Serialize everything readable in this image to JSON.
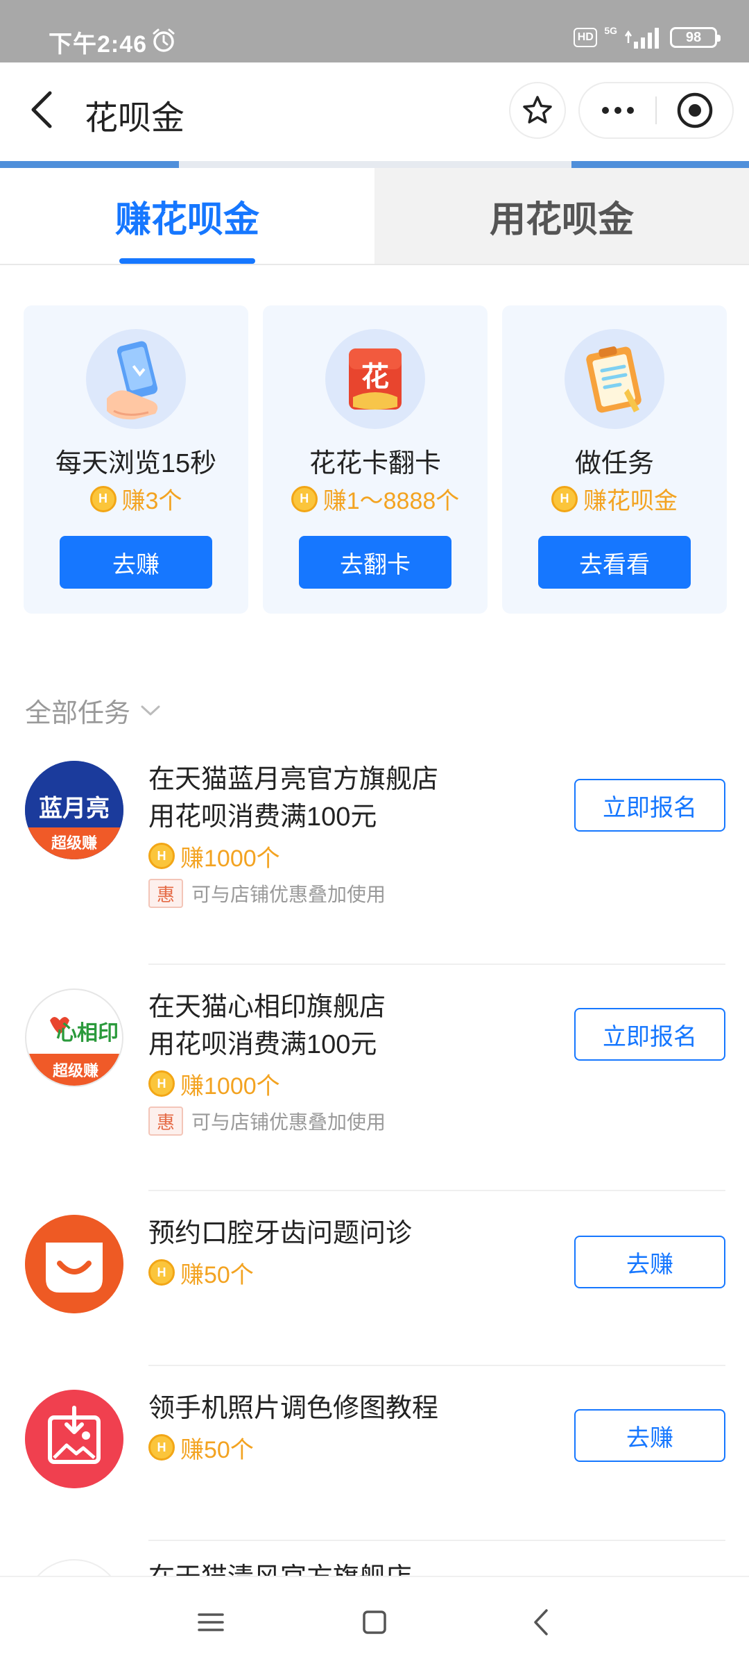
{
  "status_bar": {
    "time": "下午2:46",
    "hd": "HD",
    "network": "5G",
    "battery": "98"
  },
  "nav": {
    "title": "花呗金"
  },
  "tabs": [
    {
      "label": "赚花呗金",
      "active": true
    },
    {
      "label": "用花呗金",
      "active": false
    }
  ],
  "cards": [
    {
      "title": "每天浏览15秒",
      "reward": "赚3个",
      "button": "去赚",
      "icon": "phone-hand-icon"
    },
    {
      "title": "花花卡翻卡",
      "reward": "赚1～8888个",
      "button": "去翻卡",
      "icon": "flower-card-icon",
      "icon_text": "花"
    },
    {
      "title": "做任务",
      "reward": "赚花呗金",
      "button": "去看看",
      "icon": "clipboard-icon"
    }
  ],
  "section": {
    "title": "全部任务"
  },
  "coin_symbol": "H",
  "tasks": [
    {
      "title_line1": "在天猫蓝月亮官方旗舰店",
      "title_line2": "用花呗消费满100元",
      "reward": "赚1000个",
      "badge": "惠",
      "note": "可与店铺优惠叠加使用",
      "button": "立即报名",
      "logo_text": "蓝月亮",
      "logo_sub": "超级赚"
    },
    {
      "title_line1": "在天猫心相印旗舰店",
      "title_line2": "用花呗消费满100元",
      "reward": "赚1000个",
      "badge": "惠",
      "note": "可与店铺优惠叠加使用",
      "button": "立即报名",
      "logo_text": "心相印",
      "logo_sub": "超级赚"
    },
    {
      "title_line1": "预约口腔牙齿问题问诊",
      "reward": "赚50个",
      "button": "去赚"
    },
    {
      "title_line1": "领手机照片调色修图教程",
      "reward": "赚50个",
      "button": "去赚"
    },
    {
      "title_line1": "在天猫清风官方旗舰店"
    }
  ],
  "colors": {
    "primary": "#1677ff",
    "coin": "#f3a321",
    "card_bg": "#f2f7fe",
    "status_bar": "#a8a8a8"
  }
}
